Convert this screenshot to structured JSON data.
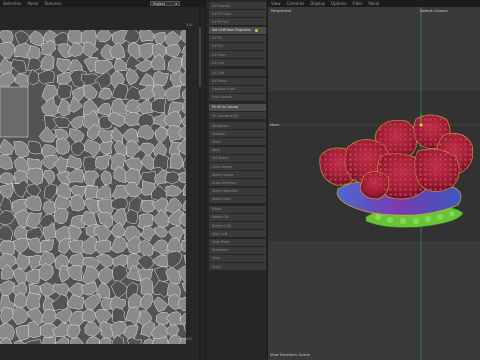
{
  "uv_menu": [
    "Selection",
    "Panel",
    "Textures"
  ],
  "uv_dropdown": "Project",
  "uv_corner_top": "1.0",
  "uv_corner_bottom": "1.0",
  "viewport_menu": [
    "View",
    "Cameras",
    "Display",
    "Options",
    "Filter",
    "Panel"
  ],
  "viewport": {
    "projection": "Perspective",
    "camera_label": "Default Camera",
    "axis_label": "Move",
    "status": "View Transform: Scene"
  },
  "commands": [
    {
      "label": "UV Unwrap",
      "active": false
    },
    {
      "label": "UV Fill Color",
      "active": false
    },
    {
      "label": "UV Fit Poly",
      "active": false
    },
    {
      "label": "Set UVW from Projection",
      "active": true
    },
    {
      "label": "UV Fill",
      "active": false
    },
    {
      "label": "UV Flip",
      "active": false
    },
    {
      "label": "UV Align",
      "active": false
    },
    {
      "label": "UV Grid",
      "active": false
    },
    {
      "label": "UV Grid",
      "active": false,
      "sep": true
    },
    {
      "label": "UV Relax",
      "active": false
    },
    {
      "label": "Equalize Scale",
      "active": false
    },
    {
      "label": "Pack Islands",
      "active": false
    },
    {
      "label": "Fit UV to Canvas",
      "active": true,
      "sep": true
    },
    {
      "label": "Fit Canvas to UV",
      "active": false
    },
    {
      "label": "Straighten",
      "active": false,
      "sep": true
    },
    {
      "label": "Unstitch",
      "active": false
    },
    {
      "label": "Stitch",
      "active": false
    },
    {
      "label": "Weld",
      "active": false
    },
    {
      "label": "Set Seams",
      "active": false
    },
    {
      "label": "Clear Seams",
      "active": false
    },
    {
      "label": "Select Seams",
      "active": false
    },
    {
      "label": "Grow Selection",
      "active": false
    },
    {
      "label": "Shrink Selection",
      "active": false
    },
    {
      "label": "Select Shell",
      "active": false
    },
    {
      "label": "Mirror",
      "active": false,
      "sep": true
    },
    {
      "label": "Rotate CW",
      "active": false
    },
    {
      "label": "Rotate CCW",
      "active": false
    },
    {
      "label": "Align Left",
      "active": false
    },
    {
      "label": "Align Right",
      "active": false
    },
    {
      "label": "Distribute",
      "active": false
    },
    {
      "label": "Snap",
      "active": false
    },
    {
      "label": "Scale",
      "active": false
    }
  ],
  "colors": {
    "uv_bg": "#535353",
    "uv_shell": "#8a8a8a",
    "uv_edge": "#e6e6e6",
    "coral": "#b0203a",
    "base_blue": "#5a3fb0",
    "base_green": "#6ac43a",
    "wire": "#e0a030"
  }
}
